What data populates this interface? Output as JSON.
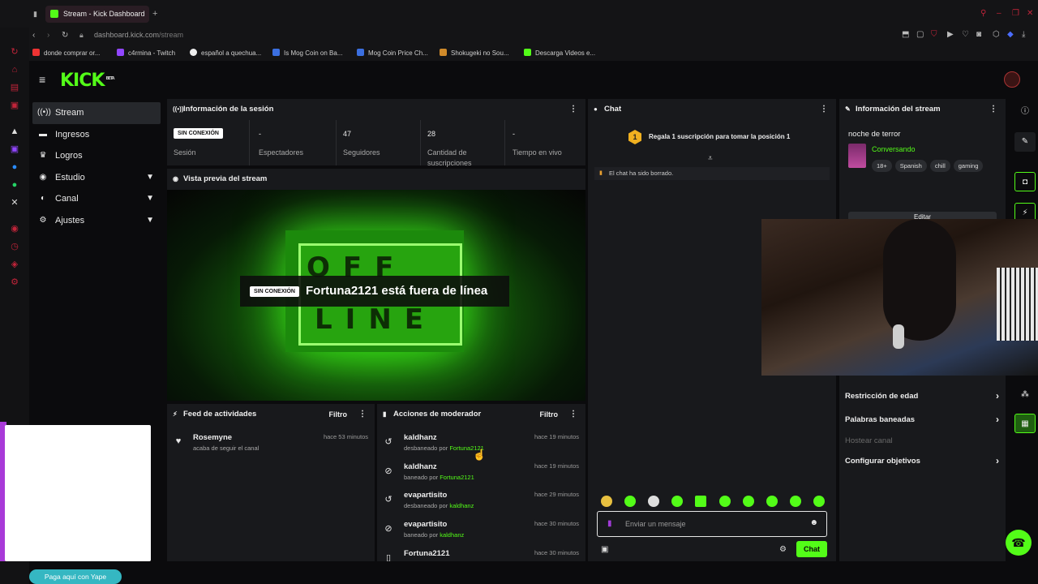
{
  "browser": {
    "tab_title": "Stream - Kick Dashboard",
    "url_host": "dashboard.kick.com",
    "url_path": "/stream",
    "bookmarks": [
      {
        "label": "donde comprar or...",
        "color": "#e33"
      },
      {
        "label": "c4rmina - Twitch",
        "color": "#9146ff"
      },
      {
        "label": "español a quechua...",
        "color": "#eee"
      },
      {
        "label": "Is Mog Coin on Ba...",
        "color": "#3b6fe0"
      },
      {
        "label": "Mog Coin Price Ch...",
        "color": "#3b6fe0"
      },
      {
        "label": "Shokugeki no Sou...",
        "color": "#d08a2a"
      },
      {
        "label": "Descarga Videos e...",
        "color": "#53fc18"
      }
    ]
  },
  "kick": {
    "logo": "KICK",
    "logo_badge": "BETA",
    "nav": [
      {
        "label": "Stream",
        "icon": "broadcast-icon",
        "active": true,
        "expand": false
      },
      {
        "label": "Ingresos",
        "icon": "wallet-icon",
        "active": false,
        "expand": false
      },
      {
        "label": "Logros",
        "icon": "trophy-icon",
        "active": false,
        "expand": false
      },
      {
        "label": "Estudio",
        "icon": "camera-icon",
        "active": false,
        "expand": true
      },
      {
        "label": "Canal",
        "icon": "people-icon",
        "active": false,
        "expand": true
      },
      {
        "label": "Ajustes",
        "icon": "gear-icon",
        "active": false,
        "expand": true
      }
    ]
  },
  "session": {
    "title": "Información de la sesión",
    "status_badge": "SIN CONEXIÓN",
    "status_label": "Sesión",
    "stats": [
      {
        "value": "-",
        "label": "Espectadores"
      },
      {
        "value": "47",
        "label": "Seguidores"
      },
      {
        "value": "28",
        "label": "Cantidad de suscripciones"
      },
      {
        "value": "-",
        "label": "Tiempo en vivo"
      }
    ]
  },
  "preview": {
    "title": "Vista previa del stream",
    "badge": "SIN CONEXIÓN",
    "message": "Fortuna2121 está fuera de línea",
    "sign_top": "OFF",
    "sign_bottom": "LINE"
  },
  "activity": {
    "title": "Feed de actividades",
    "filter": "Filtro",
    "items": [
      {
        "name": "Rosemyne",
        "sub": "acaba de seguir el canal",
        "time": "hace 53 minutos"
      }
    ]
  },
  "moderator": {
    "title": "Acciones de moderador",
    "filter": "Filtro",
    "items": [
      {
        "name": "kaldhanz",
        "action": "desbaneado por",
        "by": "Fortuna2121",
        "time": "hace 19 minutos",
        "icon": "undo-icon"
      },
      {
        "name": "kaldhanz",
        "action": "baneado por",
        "by": "Fortuna2121",
        "time": "hace 19 minutos",
        "icon": "ban-icon"
      },
      {
        "name": "evapartisito",
        "action": "desbaneado por",
        "by": "kaldhanz",
        "time": "hace 29 minutos",
        "icon": "undo-icon"
      },
      {
        "name": "evapartisito",
        "action": "baneado por",
        "by": "kaldhanz",
        "time": "hace 30 minutos",
        "icon": "ban-icon"
      },
      {
        "name": "Fortuna2121",
        "action": "",
        "by": "",
        "time": "hace 30 minutos",
        "icon": "trash-icon"
      }
    ]
  },
  "chat": {
    "title": "Chat",
    "pinned_rank": "1",
    "pinned_text": "Regala 1 suscripción para tomar la posición 1",
    "cleared": "El chat ha sido borrado.",
    "input_placeholder": "Enviar un mensaje",
    "send_label": "Chat"
  },
  "stream_info": {
    "title": "Información del stream",
    "stream_title": "noche de terror",
    "category": "Conversando",
    "tags": [
      "18+",
      "Spanish",
      "chill",
      "gaming"
    ],
    "edit_label": "Editar",
    "menu": [
      {
        "label": "Restricción de edad",
        "arrow": true,
        "muted": false
      },
      {
        "label": "Palabras baneadas",
        "arrow": true,
        "muted": false
      },
      {
        "label": "Hostear canal",
        "arrow": false,
        "muted": true
      },
      {
        "label": "Configurar objetivos",
        "arrow": true,
        "muted": false
      }
    ]
  },
  "overlay": {
    "yape_label": "Paga aquí con Yape"
  },
  "colors": {
    "kick_green": "#53fc18",
    "panel_bg": "#18191c",
    "opera_red": "#c2243a"
  }
}
